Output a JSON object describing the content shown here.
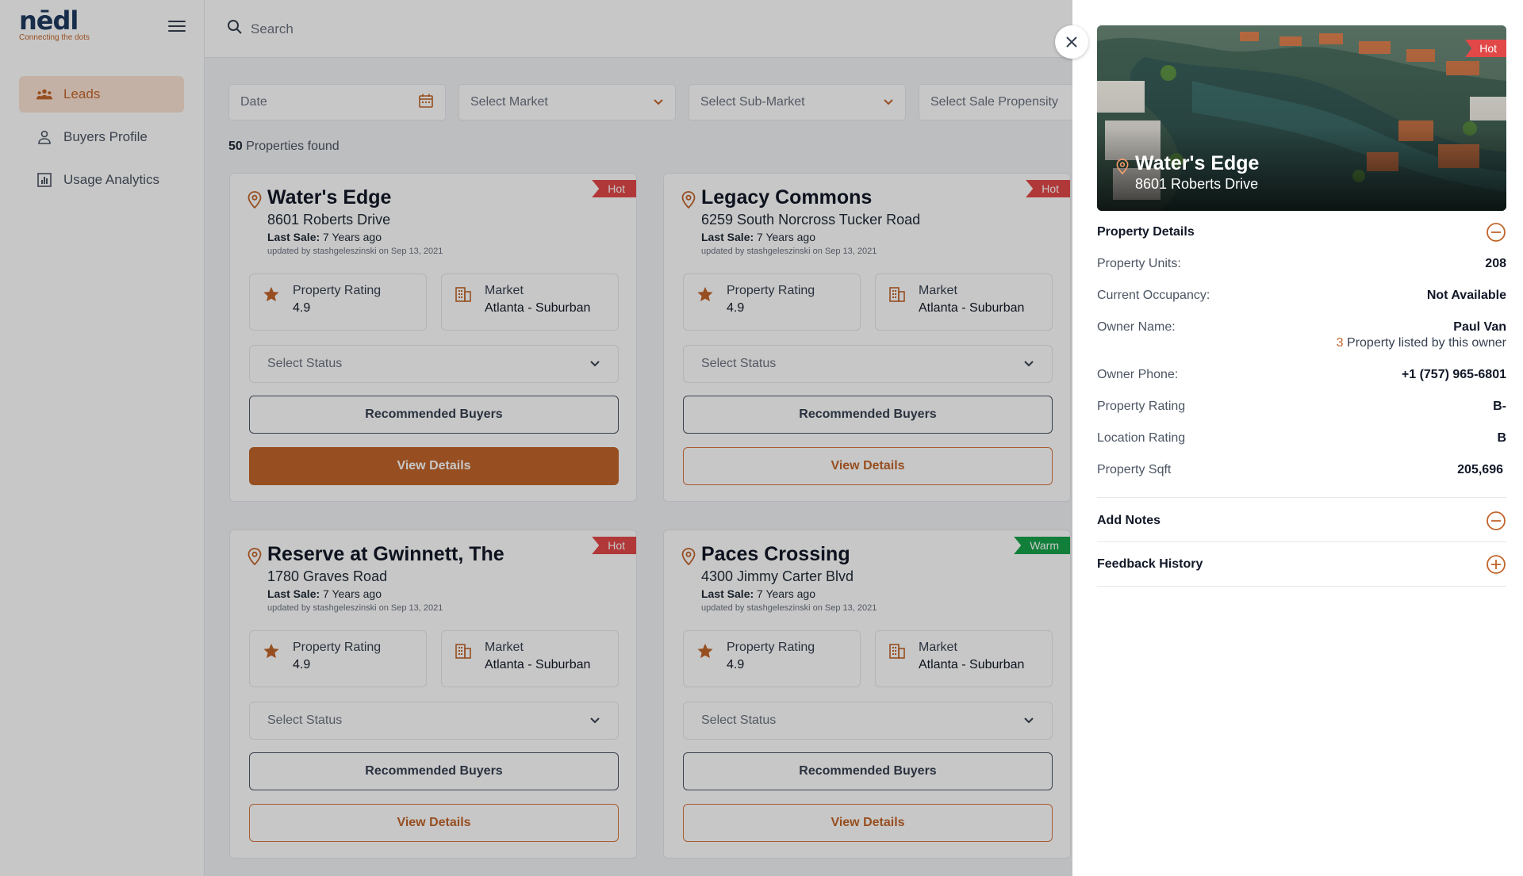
{
  "app": {
    "logo": "nēdl",
    "tagline": "Connecting the dots"
  },
  "sidebar": {
    "items": [
      {
        "label": "Leads",
        "icon": "users-icon",
        "active": true
      },
      {
        "label": "Buyers Profile",
        "icon": "user-icon",
        "active": false
      },
      {
        "label": "Usage Analytics",
        "icon": "chart-icon",
        "active": false
      }
    ]
  },
  "search": {
    "placeholder": "Search"
  },
  "filters": {
    "date": "Date",
    "market": "Select Market",
    "sub_market": "Select Sub-Market",
    "sale_propensity": "Select Sale Propensity"
  },
  "results": {
    "count": "50",
    "label": "Properties found"
  },
  "cards": [
    {
      "title": "Water's Edge",
      "address": "8601 Roberts Drive",
      "last_sale_label": "Last Sale:",
      "last_sale": "7 Years ago",
      "updated": "updated by stashgeleszinski on Sep 13, 2021",
      "badge": "Hot",
      "rating_label": "Property Rating",
      "rating": "4.9",
      "market_label": "Market",
      "market": "Atlanta - Suburban",
      "status": "Select Status",
      "rec_label": "Recommended Buyers",
      "view_label": "View Details"
    },
    {
      "title": "Legacy Commons",
      "address": "6259 South Norcross Tucker Road",
      "last_sale_label": "Last Sale:",
      "last_sale": "7 Years ago",
      "updated": "updated by stashgeleszinski on Sep 13, 2021",
      "badge": "Hot",
      "rating_label": "Property Rating",
      "rating": "4.9",
      "market_label": "Market",
      "market": "Atlanta - Suburban",
      "status": "Select Status",
      "rec_label": "Recommended Buyers",
      "view_label": "View Details"
    },
    {
      "title": "Reserve at Gwinnett, The",
      "address": "1780 Graves Road",
      "last_sale_label": "Last Sale:",
      "last_sale": "7 Years ago",
      "updated": "updated by stashgeleszinski on Sep 13, 2021",
      "badge": "Hot",
      "rating_label": "Property Rating",
      "rating": "4.9",
      "market_label": "Market",
      "market": "Atlanta - Suburban",
      "status": "Select Status",
      "rec_label": "Recommended Buyers",
      "view_label": "View Details"
    },
    {
      "title": "Paces Crossing",
      "address": "4300 Jimmy Carter Blvd",
      "last_sale_label": "Last Sale:",
      "last_sale": "7 Years ago",
      "updated": "updated by stashgeleszinski on Sep 13, 2021",
      "badge": "Warm",
      "rating_label": "Property Rating",
      "rating": "4.9",
      "market_label": "Market",
      "market": "Atlanta - Suburban",
      "status": "Select Status",
      "rec_label": "Recommended Buyers",
      "view_label": "View Details"
    }
  ],
  "drawer": {
    "badge": "Hot",
    "title": "Water's Edge",
    "address": "8601 Roberts Drive",
    "property_details": {
      "heading": "Property Details",
      "units_label": "Property Units:",
      "units": "208",
      "occupancy_label": "Current Occupancy:",
      "occupancy": "Not Available",
      "owner_label": "Owner Name:",
      "owner": "Paul Van",
      "owner_count": "3",
      "owner_count_text": "Property listed by this owner",
      "phone_label": "Owner Phone:",
      "phone": "+1 (757) 965-6801",
      "rating_label": "Property Rating",
      "rating": "B-",
      "location_label": "Location Rating",
      "location": "B",
      "sqft_label": "Property Sqft",
      "sqft": "205,696"
    },
    "add_notes": "Add Notes",
    "feedback_history": "Feedback History"
  },
  "colors": {
    "accent": "#c2652a",
    "hot": "#e34848",
    "warm": "#16a34a",
    "navy": "#1e3a5f"
  }
}
